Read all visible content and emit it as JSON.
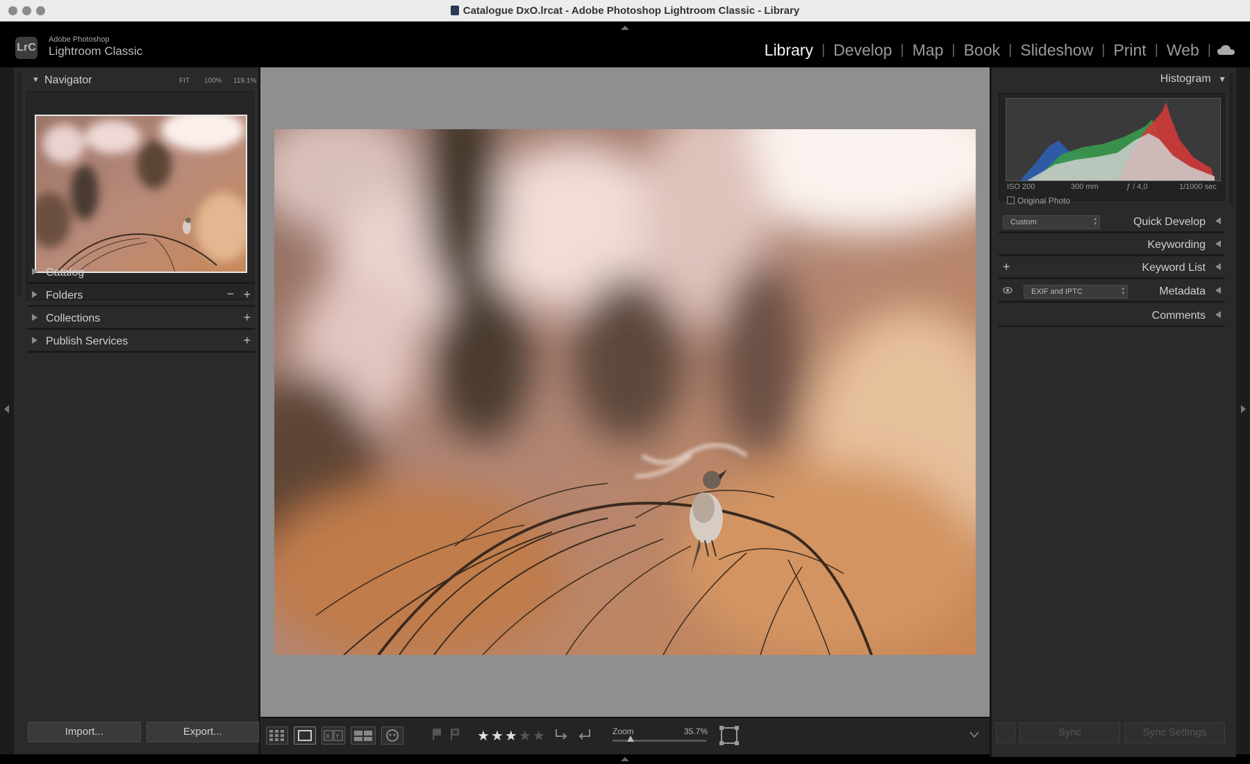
{
  "window": {
    "title": "Catalogue DxO.lrcat - Adobe Photoshop Lightroom Classic - Library"
  },
  "identity": {
    "logo": "LrC",
    "line1": "Adobe Photoshop",
    "line2": "Lightroom Classic"
  },
  "modules": [
    {
      "label": "Library",
      "active": true
    },
    {
      "label": "Develop",
      "active": false
    },
    {
      "label": "Map",
      "active": false
    },
    {
      "label": "Book",
      "active": false
    },
    {
      "label": "Slideshow",
      "active": false
    },
    {
      "label": "Print",
      "active": false
    },
    {
      "label": "Web",
      "active": false
    }
  ],
  "left_panel": {
    "navigator": {
      "label": "Navigator",
      "zoom_fit": "FIT",
      "zoom_100": "100%",
      "zoom_custom": "119.1%"
    },
    "sections": [
      {
        "label": "Catalog"
      },
      {
        "label": "Folders"
      },
      {
        "label": "Collections"
      },
      {
        "label": "Publish Services"
      }
    ],
    "import_label": "Import...",
    "export_label": "Export..."
  },
  "toolbar": {
    "rating": 3,
    "rating_max": 5,
    "zoom_label": "Zoom",
    "zoom_value": "35.7%"
  },
  "right_panel": {
    "histogram": {
      "label": "Histogram",
      "iso": "ISO 200",
      "focal": "300 mm",
      "aperture": "ƒ / 4,0",
      "shutter": "1/1000 sec",
      "original_photo": "Original Photo"
    },
    "quick_develop": {
      "label": "Quick Develop",
      "preset": "Custom"
    },
    "keywording": {
      "label": "Keywording"
    },
    "keyword_list": {
      "label": "Keyword List"
    },
    "metadata": {
      "label": "Metadata",
      "preset": "EXIF and IPTC"
    },
    "comments": {
      "label": "Comments"
    },
    "sync_label": "Sync",
    "sync_settings_label": "Sync Settings"
  },
  "icons": {
    "cloud": "cloud-icon",
    "grid": "grid-view-icon",
    "loupe": "loupe-view-icon",
    "compare": "compare-view-icon",
    "survey": "survey-view-icon",
    "people": "people-view-icon"
  }
}
